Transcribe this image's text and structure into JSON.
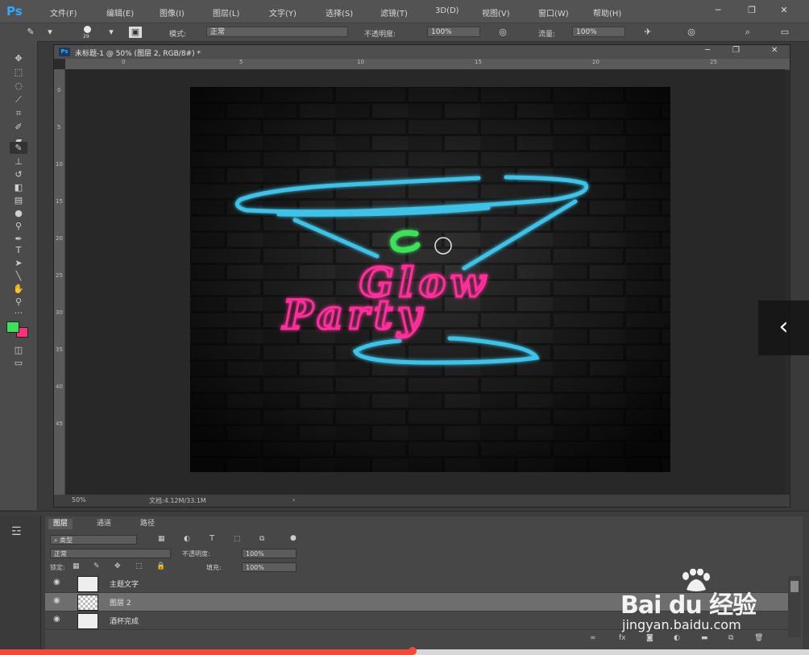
{
  "app": {
    "logo": "Ps",
    "menu": [
      "文件(F)",
      "编辑(E)",
      "图像(I)",
      "图层(L)",
      "文字(Y)",
      "选择(S)",
      "滤镜(T)",
      "3D(D)",
      "视图(V)",
      "窗口(W)",
      "帮助(H)"
    ]
  },
  "options": {
    "brush_size": "29",
    "mode_label": "模式:",
    "mode_value": "正常",
    "opacity_label": "不透明度:",
    "opacity_value": "100%",
    "flow_label": "流量:",
    "flow_value": "100%"
  },
  "document": {
    "tab_title": "未标题-1 @ 50% (图层 2, RGB/8#) *",
    "ruler_h": [
      "0",
      "5",
      "10",
      "15",
      "20",
      "25"
    ],
    "ruler_v": [
      "0",
      "5",
      "10",
      "15",
      "20",
      "25",
      "30",
      "35",
      "40",
      "45"
    ],
    "zoom": "50%",
    "doc_info": "文档:4.12M/33.1M",
    "artwork": {
      "line1": "Glow",
      "line2": "Party",
      "glass_color": "#3cc3e8",
      "text_color": "#ff2f9a",
      "olive_color": "#3ee05a"
    }
  },
  "layers_panel": {
    "tabs": [
      "图层",
      "通道",
      "路径"
    ],
    "filter_kind": "类型",
    "blend_mode": "正常",
    "opacity_label": "不透明度:",
    "opacity_value": "100%",
    "lock_label": "锁定:",
    "fill_label": "填充:",
    "fill_value": "100%",
    "layers": [
      {
        "name": "主题文字",
        "selected": false
      },
      {
        "name": "图层 2",
        "selected": true
      },
      {
        "name": "酒杯完成",
        "selected": false
      }
    ]
  },
  "colors": {
    "foreground": "#3ee05a",
    "background": "#ff2f7a"
  },
  "watermark": {
    "text": "Bai du 经验",
    "url": "jingyan.baidu.com"
  },
  "video": {
    "progress_percent": 51
  }
}
